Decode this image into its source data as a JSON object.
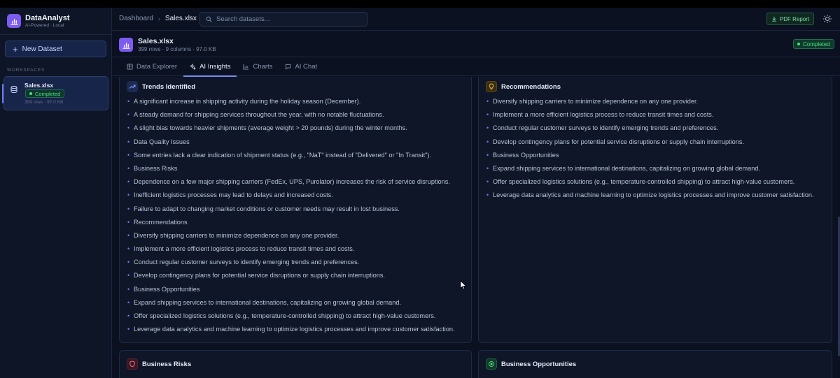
{
  "app": {
    "name": "DataAnalyst",
    "tagline": "AI-Powered · Local",
    "new_dataset_label": "New Dataset",
    "workspaces_label": "WORKSPACES",
    "workspace_item": {
      "title": "Sales.xlsx",
      "status": "Completed",
      "meta": "399 rows · 97.0 KB"
    }
  },
  "header": {
    "breadcrumb_root": "Dashboard",
    "breadcrumb_current": "Sales.xlsx",
    "search_placeholder": "Search datasets...",
    "pdf_label": "PDF Report"
  },
  "dataset": {
    "title": "Sales.xlsx",
    "meta": "399 rows  · 9 columns  · 97.0 KB",
    "status": "Completed"
  },
  "tabs": [
    {
      "label": "Data Explorer"
    },
    {
      "label": "AI Insights"
    },
    {
      "label": "Charts"
    },
    {
      "label": "AI Chat"
    }
  ],
  "cards": {
    "trends": {
      "title": "Trends Identified",
      "items": [
        "A significant increase in shipping activity during the holiday season (December).",
        "A steady demand for shipping services throughout the year, with no notable fluctuations.",
        "A slight bias towards heavier shipments (average weight > 20 pounds) during the winter months.",
        "Data Quality Issues",
        "Some entries lack a clear indication of shipment status (e.g., \"NaT\" instead of \"Delivered\" or \"In Transit\").",
        "Business Risks",
        "Dependence on a few major shipping carriers (FedEx, UPS, Purolator) increases the risk of service disruptions.",
        "Inefficient logistics processes may lead to delays and increased costs.",
        "Failure to adapt to changing market conditions or customer needs may result in lost business.",
        "Recommendations",
        "Diversify shipping carriers to minimize dependence on any one provider.",
        "Implement a more efficient logistics process to reduce transit times and costs.",
        "Conduct regular customer surveys to identify emerging trends and preferences.",
        "Develop contingency plans for potential service disruptions or supply chain interruptions.",
        "Business Opportunities",
        "Expand shipping services to international destinations, capitalizing on growing global demand.",
        "Offer specialized logistics solutions (e.g., temperature-controlled shipping) to attract high-value customers.",
        "Leverage data analytics and machine learning to optimize logistics processes and improve customer satisfaction."
      ]
    },
    "recommendations": {
      "title": "Recommendations",
      "items": [
        "Diversify shipping carriers to minimize dependence on any one provider.",
        "Implement a more efficient logistics process to reduce transit times and costs.",
        "Conduct regular customer surveys to identify emerging trends and preferences.",
        "Develop contingency plans for potential service disruptions or supply chain interruptions.",
        "Business Opportunities",
        "Expand shipping services to international destinations, capitalizing on growing global demand.",
        "Offer specialized logistics solutions (e.g., temperature-controlled shipping) to attract high-value customers.",
        "Leverage data analytics and machine learning to optimize logistics processes and improve customer satisfaction."
      ]
    },
    "risks": {
      "title": "Business Risks"
    },
    "opportunities": {
      "title": "Business Opportunities"
    }
  },
  "colors": {
    "accent": "#7c5cf0",
    "success": "#4ade80",
    "bullet": "#6c7ef0"
  }
}
